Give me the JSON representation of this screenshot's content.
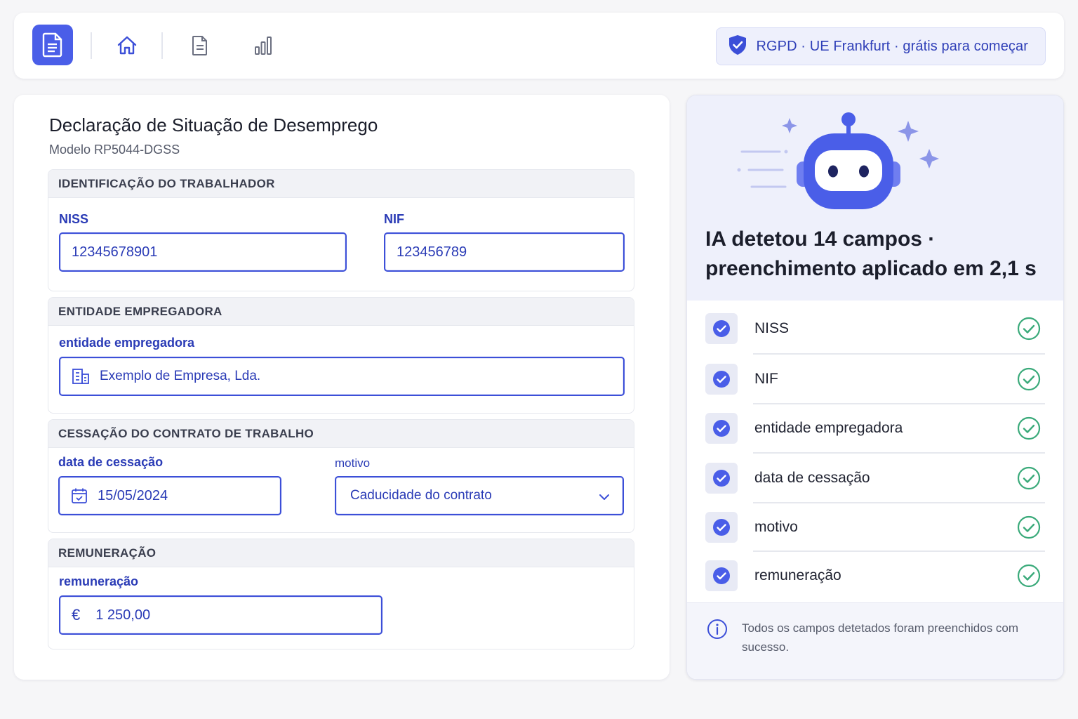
{
  "topbar": {
    "rgpd_text": "RGPD · UE Frankfurt · grátis para começar"
  },
  "form": {
    "title": "Declaração de Situação de Desemprego",
    "subtitle": "Modelo RP5044-DGSS",
    "sections": {
      "identification": {
        "heading": "IDENTIFICAÇÃO DO TRABALHADOR",
        "niss_label": "NISS",
        "niss_value": "12345678901",
        "nif_label": "NIF",
        "nif_value": "123456789"
      },
      "employer": {
        "heading": "ENTIDADE EMPREGADORA",
        "label": "entidade empregadora",
        "value": "Exemplo de Empresa, Lda."
      },
      "termination": {
        "heading": "CESSAÇÃO DO CONTRATO DE TRABALHO",
        "date_label": "data de cessação",
        "date_value": "15/05/2024",
        "reason_label": "motivo",
        "reason_value": "Caducidade do contrato"
      },
      "remuneration": {
        "heading": "REMUNERAÇÃO",
        "label": "remuneração",
        "currency": "€",
        "value": "1 250,00"
      }
    }
  },
  "ai_panel": {
    "headline": "IA detetou 14 campos · preenchimento aplicado em 2,1 s",
    "items": [
      {
        "label": "NISS"
      },
      {
        "label": "NIF"
      },
      {
        "label": "entidade empregadora"
      },
      {
        "label": "data de cessação"
      },
      {
        "label": "motivo"
      },
      {
        "label": "remuneração"
      }
    ],
    "footer": "Todos os campos detetados foram preenchidos com sucesso."
  },
  "colors": {
    "accent": "#4a5ee8",
    "accent_dark": "#2a3bb6",
    "success": "#3aaa7a"
  },
  "icons": [
    "document-icon",
    "home-icon",
    "file-icon",
    "bar-chart-icon",
    "shield-check-icon",
    "building-icon",
    "calendar-icon",
    "chevron-down-icon",
    "check-badge-icon",
    "check-circle-icon",
    "info-icon",
    "robot-illustration"
  ]
}
